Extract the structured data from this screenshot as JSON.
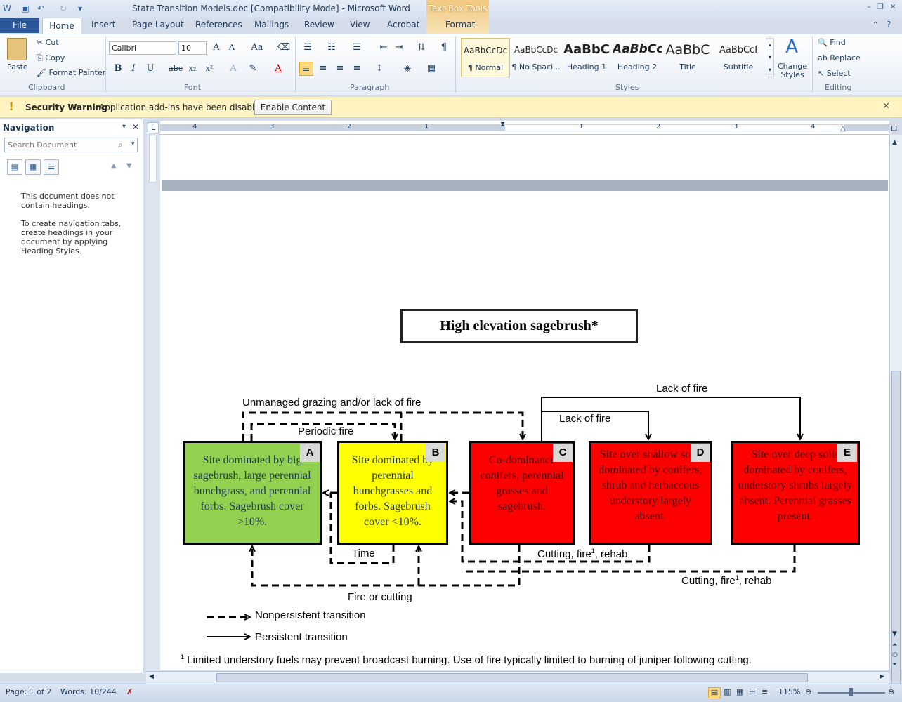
{
  "window": {
    "title": "State Transition Models.doc [Compatibility Mode]  -  Microsoft Word",
    "context_tab": "Text Box Tools"
  },
  "tabs": [
    "File",
    "Home",
    "Insert",
    "Page Layout",
    "References",
    "Mailings",
    "Review",
    "View",
    "Acrobat",
    "Format"
  ],
  "ribbon": {
    "clipboard": {
      "paste": "Paste",
      "cut": "Cut",
      "copy": "Copy",
      "format_painter": "Format Painter",
      "label": "Clipboard"
    },
    "font": {
      "name": "Calibri",
      "size": "10",
      "label": "Font"
    },
    "paragraph": {
      "label": "Paragraph"
    },
    "styles": {
      "items": [
        {
          "preview": "AaBbCcDc",
          "name": "¶ Normal"
        },
        {
          "preview": "AaBbCcDc",
          "name": "¶ No Spaci..."
        },
        {
          "preview": "AaBbC",
          "name": "Heading 1"
        },
        {
          "preview": "AaBbCc",
          "name": "Heading 2"
        },
        {
          "preview": "AaBbC",
          "name": "Title"
        },
        {
          "preview": "AaBbCcI",
          "name": "Subtitle"
        }
      ],
      "change_styles": "Change Styles",
      "label": "Styles"
    },
    "editing": {
      "find": "Find",
      "replace": "Replace",
      "select": "Select",
      "label": "Editing"
    }
  },
  "security": {
    "title": "Security Warning",
    "message": "Application add-ins have been disabled.",
    "button": "Enable Content"
  },
  "navigation": {
    "title": "Navigation",
    "search_placeholder": "Search Document",
    "msg1": "This document does not contain headings.",
    "msg2": "To create navigation tabs, create headings in your document by applying Heading Styles."
  },
  "ruler": {
    "numbers": [
      "4",
      "3",
      "2",
      "1",
      "1",
      "2",
      "3",
      "4"
    ]
  },
  "diagram": {
    "title": "High  elevation sagebrush*",
    "states": [
      {
        "id": "A",
        "text": "Site dominated by big sagebrush, large perennial bunchgrass, and perennial forbs.  Sagebrush cover >10%.",
        "color": "#92d050"
      },
      {
        "id": "B",
        "text": "Site dominated by perennial bunchgrasses and forbs.  Sagebrush cover <10%.",
        "color": "#ffff00"
      },
      {
        "id": "C",
        "text": "Co-dominance conifers, perennial grasses and sagebrush.",
        "color": "#ff0000"
      },
      {
        "id": "D",
        "text": "Site over shallow soils dominated by conifers; shrub and herbaceous understory largely absent.",
        "color": "#ff0000"
      },
      {
        "id": "E",
        "text": "Site over deep soils dominated by conifers, understory shrubs largely absent.  Perennial grasses present.",
        "color": "#ff0000"
      }
    ],
    "labels": {
      "lack_of_fire_top": "Lack of fire",
      "lack_of_fire": "Lack of fire",
      "unmanaged": "Unmanaged grazing and/or lack of fire",
      "periodic_fire": "Periodic fire",
      "time": "Time",
      "cutting1_a": "Cutting, fire",
      "cutting1_b": ", rehab",
      "cutting2_a": "Cutting, fire",
      "cutting2_b": ", rehab",
      "sup": "1",
      "fire_or_cutting": "Fire or cutting"
    },
    "legend": {
      "nonpersistent": "Nonpersistent transition",
      "persistent": "Persistent transition"
    },
    "footnote_mark": "1",
    "footnote": " Limited understory fuels may prevent broadcast burning.  Use of fire typically limited to burning of juniper following cutting."
  },
  "status": {
    "page": "Page: 1 of 2",
    "words": "Words: 10/244",
    "zoom": "115%"
  }
}
